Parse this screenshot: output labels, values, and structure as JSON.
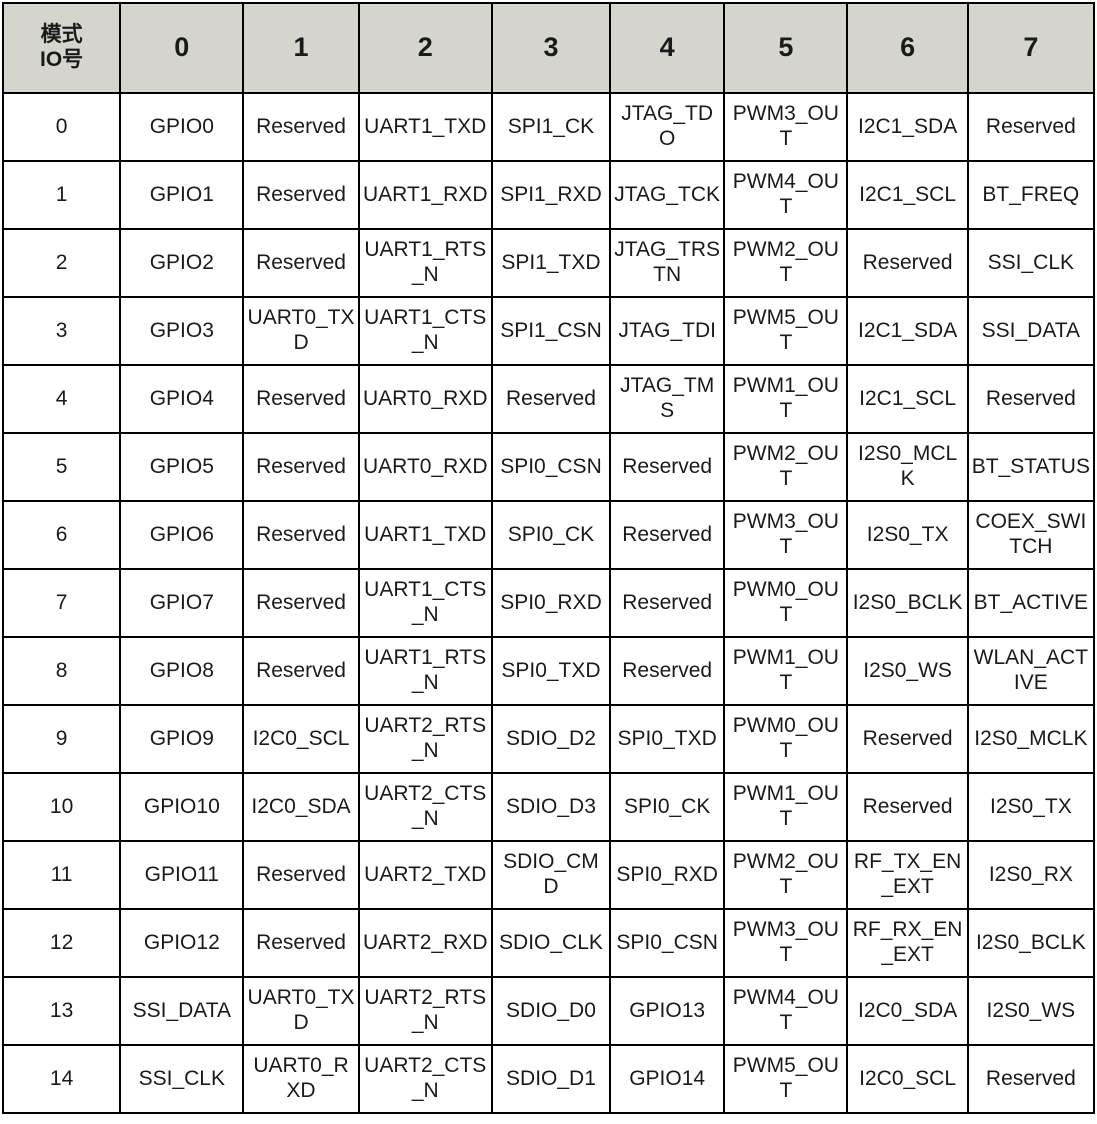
{
  "table": {
    "corner_header": {
      "mode_label": "模式",
      "io_label": "IO号"
    },
    "mode_columns": [
      "0",
      "1",
      "2",
      "3",
      "4",
      "5",
      "6",
      "7"
    ],
    "rows": [
      {
        "io": "0",
        "cells": [
          "GPIO0",
          "Reserved",
          "UART1_TXD",
          "SPI1_CK",
          "JTAG_TDO",
          "PWM3_OUT",
          "I2C1_SDA",
          "Reserved"
        ]
      },
      {
        "io": "1",
        "cells": [
          "GPIO1",
          "Reserved",
          "UART1_RXD",
          "SPI1_RXD",
          "JTAG_TCK",
          "PWM4_OUT",
          "I2C1_SCL",
          "BT_FREQ"
        ]
      },
      {
        "io": "2",
        "cells": [
          "GPIO2",
          "Reserved",
          "UART1_RTS_N",
          "SPI1_TXD",
          "JTAG_TRSTN",
          "PWM2_OUT",
          "Reserved",
          "SSI_CLK"
        ]
      },
      {
        "io": "3",
        "cells": [
          "GPIO3",
          "UART0_TXD",
          "UART1_CTS_N",
          "SPI1_CSN",
          "JTAG_TDI",
          "PWM5_OUT",
          "I2C1_SDA",
          "SSI_DATA"
        ]
      },
      {
        "io": "4",
        "cells": [
          "GPIO4",
          "Reserved",
          "UART0_RXD",
          "Reserved",
          "JTAG_TMS",
          "PWM1_OUT",
          "I2C1_SCL",
          "Reserved"
        ]
      },
      {
        "io": "5",
        "cells": [
          "GPIO5",
          "Reserved",
          "UART0_RXD",
          "SPI0_CSN",
          "Reserved",
          "PWM2_OUT",
          "I2S0_MCLK",
          "BT_STATUS"
        ]
      },
      {
        "io": "6",
        "cells": [
          "GPIO6",
          "Reserved",
          "UART1_TXD",
          "SPI0_CK",
          "Reserved",
          "PWM3_OUT",
          "I2S0_TX",
          "COEX_SWITCH"
        ]
      },
      {
        "io": "7",
        "cells": [
          "GPIO7",
          "Reserved",
          "UART1_CTS_N",
          "SPI0_RXD",
          "Reserved",
          "PWM0_OUT",
          "I2S0_BCLK",
          "BT_ACTIVE"
        ]
      },
      {
        "io": "8",
        "cells": [
          "GPIO8",
          "Reserved",
          "UART1_RTS_N",
          "SPI0_TXD",
          "Reserved",
          "PWM1_OUT",
          "I2S0_WS",
          "WLAN_ACTIVE"
        ]
      },
      {
        "io": "9",
        "cells": [
          "GPIO9",
          "I2C0_SCL",
          "UART2_RTS_N",
          "SDIO_D2",
          "SPI0_TXD",
          "PWM0_OUT",
          "Reserved",
          "I2S0_MCLK"
        ]
      },
      {
        "io": "10",
        "cells": [
          "GPIO10",
          "I2C0_SDA",
          "UART2_CTS_N",
          "SDIO_D3",
          "SPI0_CK",
          "PWM1_OUT",
          "Reserved",
          "I2S0_TX"
        ]
      },
      {
        "io": "11",
        "cells": [
          "GPIO11",
          "Reserved",
          "UART2_TXD",
          "SDIO_CMD",
          "SPI0_RXD",
          "PWM2_OUT",
          "RF_TX_EN_EXT",
          "I2S0_RX"
        ]
      },
      {
        "io": "12",
        "cells": [
          "GPIO12",
          "Reserved",
          "UART2_RXD",
          "SDIO_CLK",
          "SPI0_CSN",
          "PWM3_OUT",
          "RF_RX_EN_EXT",
          "I2S0_BCLK"
        ]
      },
      {
        "io": "13",
        "cells": [
          "SSI_DATA",
          "UART0_TXD",
          "UART2_RTS_N",
          "SDIO_D0",
          "GPIO13",
          "PWM4_OUT",
          "I2C0_SDA",
          "I2S0_WS"
        ]
      },
      {
        "io": "14",
        "cells": [
          "SSI_CLK",
          "UART0_RXD",
          "UART2_CTS_N",
          "SDIO_D1",
          "GPIO14",
          "PWM5_OUT",
          "I2C0_SCL",
          "Reserved"
        ]
      }
    ]
  },
  "colors": {
    "header_background": "#d5d5cd",
    "border": "#000000",
    "text": "#1a1a1a",
    "cell_background": "#ffffff"
  }
}
